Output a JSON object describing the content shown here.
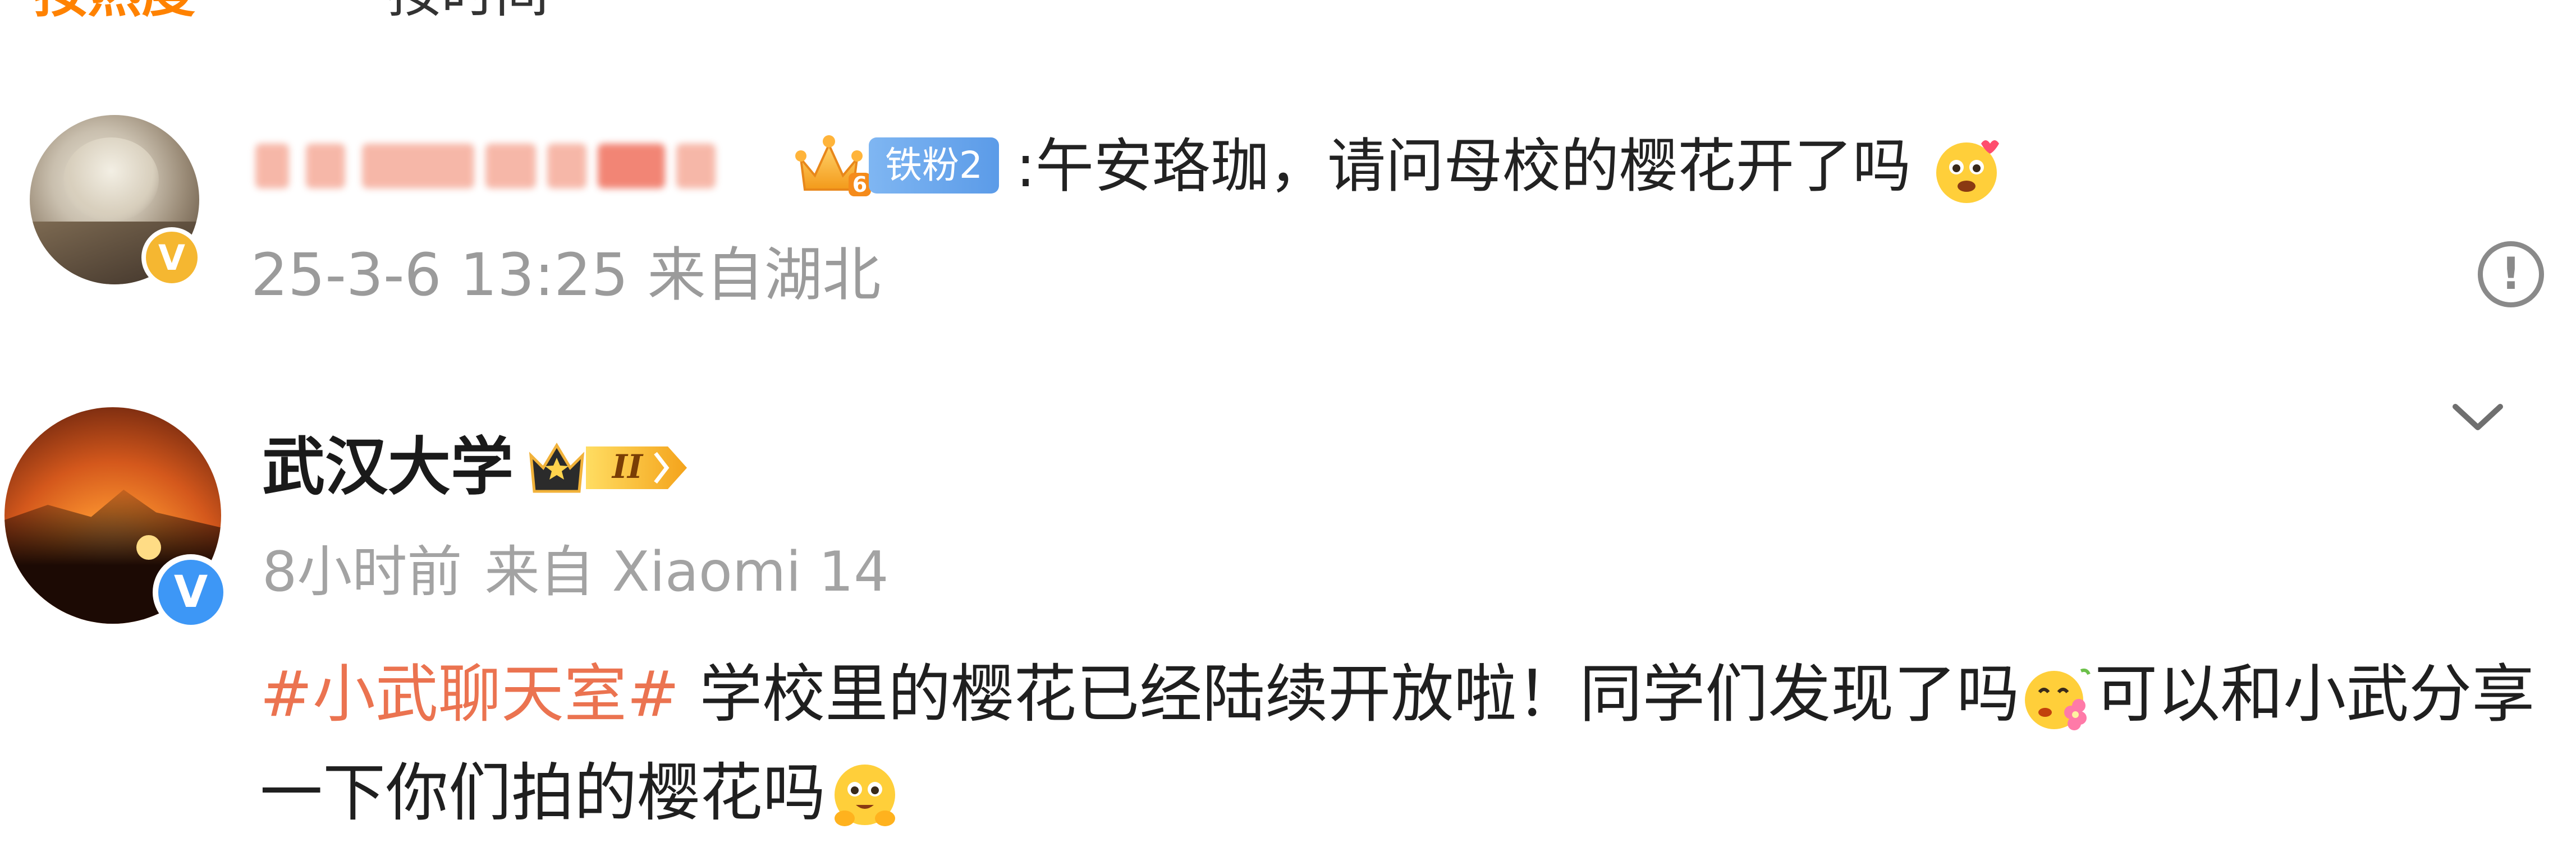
{
  "sort_bar": {
    "hot_label": "按热度",
    "time_label": "按时间"
  },
  "comments": [
    {
      "username_blurred": true,
      "fan_badge_label": "铁粉2",
      "crown_level": "6",
      "text": ":午安珞珈，请问母校的樱花开了吗",
      "timestamp": "25-3-6 13:25",
      "location": "来自湖北",
      "verified_color": "#f5b731",
      "verified_mark": "V",
      "report_icon": "!"
    },
    {
      "author": "武汉大学",
      "vip_level": "II",
      "time_ago": "8小时前",
      "source": "来自 Xiaomi 14",
      "hashtag": "#小武聊天室#",
      "body_line1": " 学校里的樱花已经陆续开放啦！同学们发现了吗",
      "body_line1_tail": "可以和小武分享",
      "body_line2": "一下你们拍的樱花吗",
      "verified_color": "#3d97f6",
      "verified_mark": "V"
    }
  ],
  "colors": {
    "accent_orange": "#ff8200",
    "hashtag": "#eb7350",
    "meta_gray": "#9b9b9b",
    "fan_badge_blue": "#5b9be8"
  }
}
